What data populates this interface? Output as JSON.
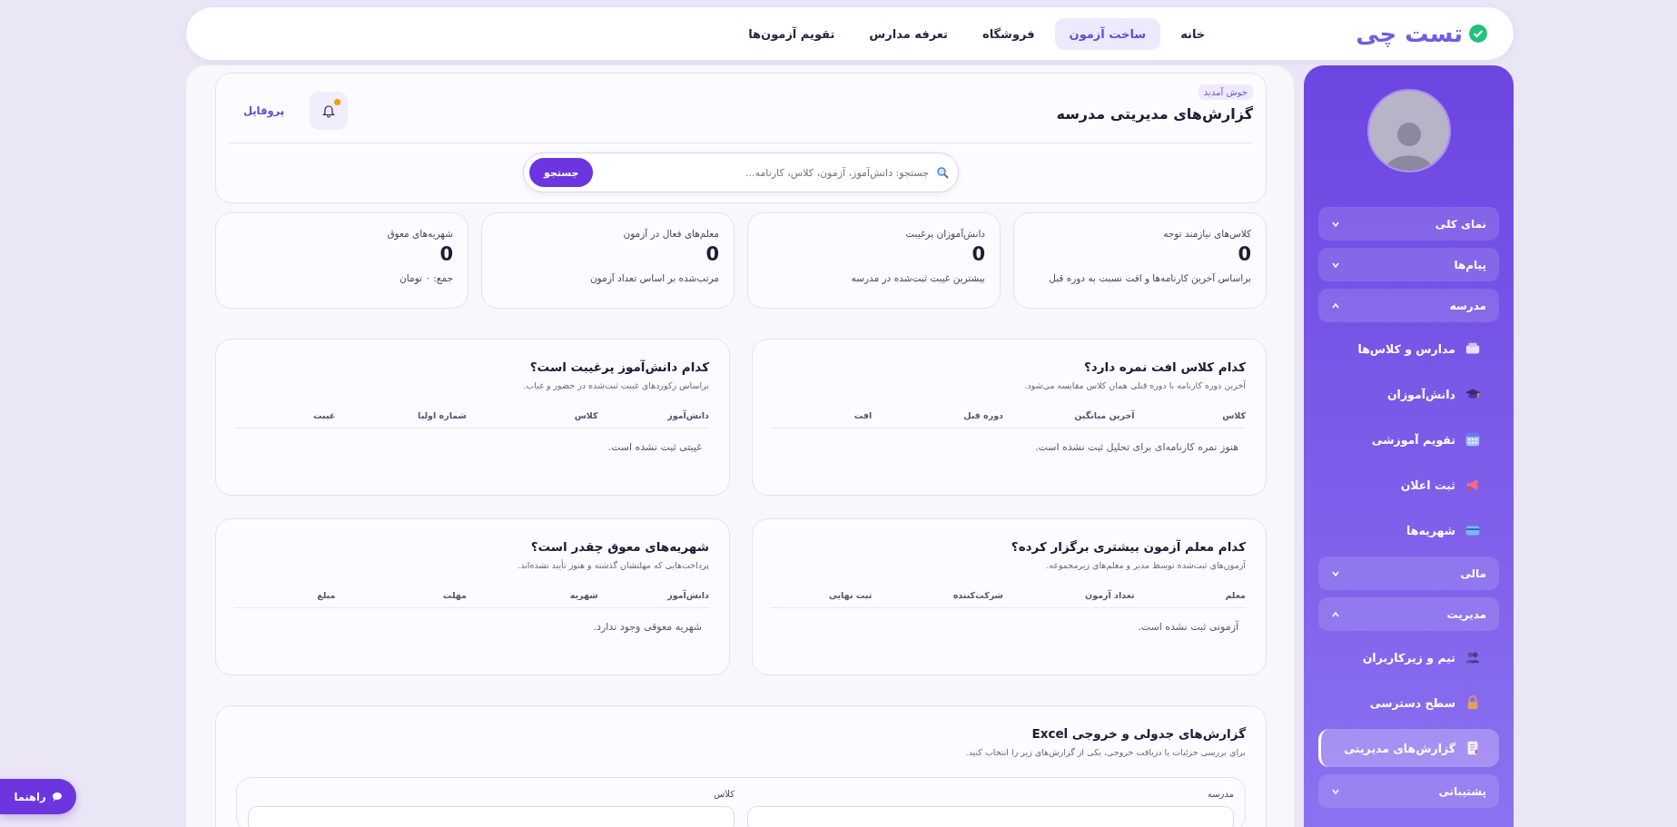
{
  "nav": {
    "logo": "تست چی",
    "links": [
      {
        "label": "خانه",
        "selected": false
      },
      {
        "label": "ساخت آزمون",
        "selected": true
      },
      {
        "label": "فروشگاه",
        "selected": false
      },
      {
        "label": "تعرفه مدارس",
        "selected": false
      },
      {
        "label": "تقویم آزمون‌ها",
        "selected": false
      }
    ]
  },
  "sidebar": {
    "groups": [
      {
        "label": "نمای کلی",
        "expanded": false
      },
      {
        "label": "پیام‌ها",
        "expanded": false
      },
      {
        "label": "مدرسه",
        "expanded": true,
        "children": [
          {
            "label": "مدارس و کلاس‌ها",
            "selected": false
          },
          {
            "label": "دانش‌آموزان",
            "selected": false
          },
          {
            "label": "تقویم آموزشی",
            "selected": false
          },
          {
            "label": "ثبت اعلان",
            "selected": false
          },
          {
            "label": "شهریه‌ها",
            "selected": false
          }
        ]
      },
      {
        "label": "مالی",
        "expanded": false
      },
      {
        "label": "مدیریت",
        "expanded": true,
        "children": [
          {
            "label": "تیم و زیرکاربران",
            "selected": false
          },
          {
            "label": "سطح دسترسی",
            "selected": false
          },
          {
            "label": "گزارش‌های مدیریتی",
            "selected": true
          }
        ]
      },
      {
        "label": "پشتیبانی",
        "expanded": false
      }
    ]
  },
  "header": {
    "badge": "خوش آمدید",
    "title": "گزارش‌های مدیریتی مدرسه",
    "profile": "پروفایل",
    "has_notification": true,
    "search": {
      "placeholder": "جستجو: دانش‌آموز، آزمون، کلاس، کارنامه...",
      "button": "جستجو"
    }
  },
  "stats": [
    {
      "label": "کلاس‌های نیازمند توجه",
      "value": "0",
      "note": "براساس آخرین کارنامه‌ها و افت نسبت به دوره قبل"
    },
    {
      "label": "دانش‌آموزان پرغیبت",
      "value": "0",
      "note": "بیشترین غیبت ثبت‌شده در مدرسه"
    },
    {
      "label": "معلم‌های فعال در آزمون",
      "value": "0",
      "note": "مرتب‌شده بر اساس تعداد آزمون"
    },
    {
      "label": "شهریه‌های معوق",
      "value": "0",
      "note": "جمع: ۰ تومان"
    }
  ],
  "panels": [
    {
      "title": "کدام کلاس افت نمره دارد؟",
      "subtitle": "آخرین دوره کارنامه با دوره قبلی همان کلاس مقایسه می‌شود.",
      "columns": [
        "کلاس",
        "آخرین میانگین",
        "دوره قبل",
        "افت"
      ],
      "empty": "هنوز نمره کارنامه‌ای برای تحلیل ثبت نشده است."
    },
    {
      "title": "کدام دانش‌آموز پرغیبت است؟",
      "subtitle": "براساس رکوردهای غیبت ثبت‌شده در حضور و غیاب.",
      "columns": [
        "دانش‌آموز",
        "کلاس",
        "شماره اولیا",
        "غیبت"
      ],
      "empty": "غیبتی ثبت نشده است."
    },
    {
      "title": "کدام معلم آزمون بیشتری برگزار کرده؟",
      "subtitle": "آزمون‌های ثبت‌شده توسط مدیر و معلم‌های زیرمجموعه.",
      "columns": [
        "معلم",
        "تعداد آزمون",
        "شرکت‌کننده",
        "ثبت نهایی"
      ],
      "empty": "آزمونی ثبت نشده است."
    },
    {
      "title": "شهریه‌های معوق چقدر است؟",
      "subtitle": "پرداخت‌هایی که مهلتشان گذشته و هنوز تأیید نشده‌اند.",
      "columns": [
        "دانش‌آموز",
        "شهریه",
        "مهلت",
        "مبلغ"
      ],
      "empty": "شهریه معوقی وجود ندارد."
    }
  ],
  "excel": {
    "title": "گزارش‌های جدولی و خروجی Excel",
    "subtitle": "برای بررسی جزئیات یا دریافت خروجی، یکی از گزارش‌های زیر را انتخاب کنید.",
    "filters": [
      {
        "label": "مدرسه"
      },
      {
        "label": "کلاس"
      }
    ]
  },
  "guide_button": "راهنما"
}
